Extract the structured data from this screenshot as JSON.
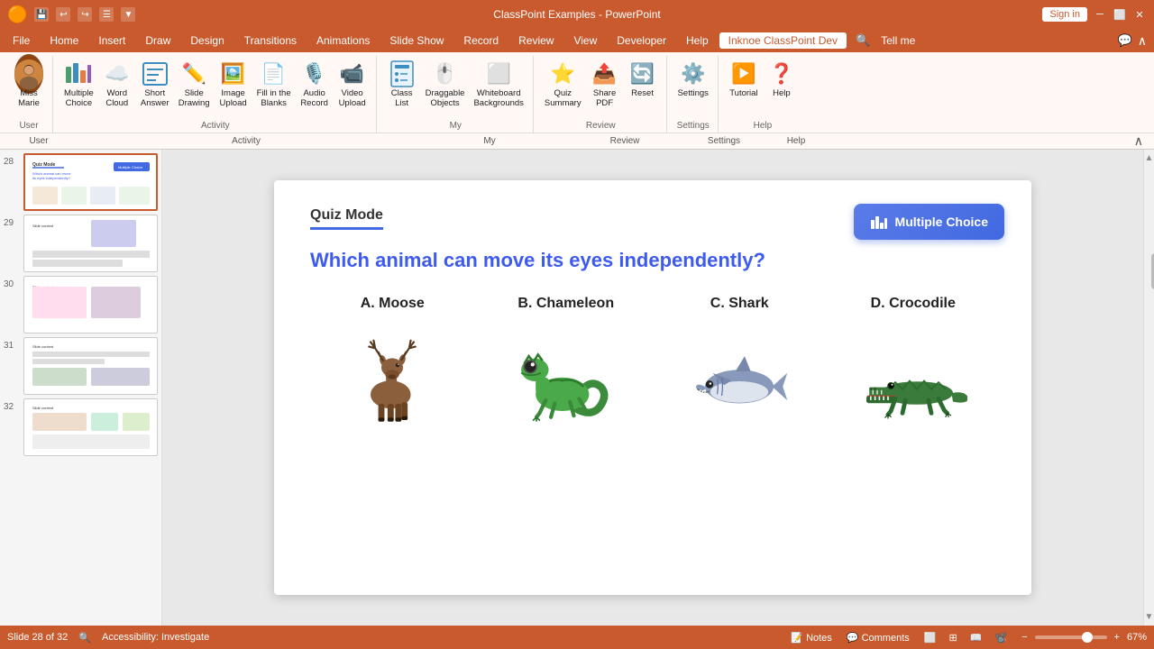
{
  "titlebar": {
    "title": "ClassPoint Examples - PowerPoint",
    "signin_label": "Sign in",
    "icons": [
      "save",
      "undo",
      "redo",
      "customize"
    ]
  },
  "menubar": {
    "items": [
      "File",
      "Home",
      "Insert",
      "Draw",
      "Design",
      "Transitions",
      "Animations",
      "Slide Show",
      "Record",
      "Review",
      "View",
      "Developer",
      "Help"
    ],
    "active": "Inknoe ClassPoint Dev",
    "extra": [
      "Tell me"
    ],
    "active_tab": "Inknoe ClassPoint Dev"
  },
  "ribbon": {
    "groups": [
      {
        "name": "User",
        "buttons": [
          {
            "label": "Miss\nMarie",
            "icon": "👤"
          }
        ]
      },
      {
        "name": "Activity",
        "buttons": [
          {
            "label": "Multiple\nChoice",
            "icon": "📊"
          },
          {
            "label": "Word\nCloud",
            "icon": "☁️"
          },
          {
            "label": "Short\nAnswer",
            "icon": "📝"
          },
          {
            "label": "Slide\nDrawing",
            "icon": "✏️"
          },
          {
            "label": "Image\nUpload",
            "icon": "🖼️"
          },
          {
            "label": "Fill in the\nBlanks",
            "icon": "📄"
          },
          {
            "label": "Audio\nRecord",
            "icon": "🎙️"
          },
          {
            "label": "Video\nUpload",
            "icon": "📹"
          }
        ]
      },
      {
        "name": "My",
        "buttons": [
          {
            "label": "Class\nList",
            "icon": "📋"
          },
          {
            "label": "Draggable\nObjects",
            "icon": "🖱️"
          },
          {
            "label": "Whiteboard\nBackgrounds",
            "icon": "⬜"
          }
        ]
      },
      {
        "name": "Review",
        "buttons": [
          {
            "label": "Quiz\nSummary",
            "icon": "⭐"
          },
          {
            "label": "Share\nPDF",
            "icon": "📤"
          },
          {
            "label": "Reset",
            "icon": "🔄"
          }
        ]
      },
      {
        "name": "Settings",
        "buttons": [
          {
            "label": "Settings",
            "icon": "⚙️"
          }
        ]
      },
      {
        "name": "Help",
        "buttons": [
          {
            "label": "Tutorial",
            "icon": "▶️"
          },
          {
            "label": "Help",
            "icon": "❓"
          }
        ]
      }
    ]
  },
  "slides": [
    {
      "number": "28",
      "active": true
    },
    {
      "number": "29",
      "active": false
    },
    {
      "number": "30",
      "active": false
    },
    {
      "number": "31",
      "active": false
    },
    {
      "number": "32",
      "active": false
    }
  ],
  "slide": {
    "mode_label": "Quiz Mode",
    "multiple_choice_btn": "Multiple Choice",
    "question": "Which animal can move its eyes independently?",
    "cursor_visible": true,
    "answers": [
      {
        "letter": "A.",
        "name": "Moose",
        "animal": "moose"
      },
      {
        "letter": "B.",
        "name": "Chameleon",
        "animal": "chameleon"
      },
      {
        "letter": "C.",
        "name": "Shark",
        "animal": "shark"
      },
      {
        "letter": "D.",
        "name": "Crocodile",
        "animal": "crocodile"
      }
    ]
  },
  "statusbar": {
    "slide_info": "Slide 28 of 32",
    "accessibility": "Accessibility: Investigate",
    "notes_label": "Notes",
    "comments_label": "Comments",
    "zoom_level": "67%"
  }
}
